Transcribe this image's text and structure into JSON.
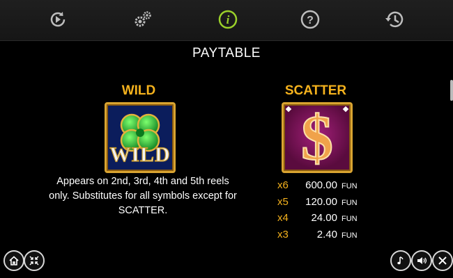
{
  "topbar": {
    "buttons": [
      {
        "name": "autoplay-button",
        "icon": "autoplay-icon"
      },
      {
        "name": "settings-button",
        "icon": "gears-icon"
      },
      {
        "name": "info-button",
        "icon": "info-icon",
        "active": true
      },
      {
        "name": "help-button",
        "icon": "question-icon"
      },
      {
        "name": "history-button",
        "icon": "history-icon"
      }
    ]
  },
  "page": {
    "title": "PAYTABLE"
  },
  "wild": {
    "title": "WILD",
    "symbol_text": "WILD",
    "description": "Appears on 2nd, 3rd, 4th and 5th reels only. Substitutes for all symbols except for SCATTER."
  },
  "scatter": {
    "title": "SCATTER",
    "symbol_glyph": "$",
    "payouts": [
      {
        "multiplier": "x6",
        "value": "600.00",
        "currency": "FUN"
      },
      {
        "multiplier": "x5",
        "value": "120.00",
        "currency": "FUN"
      },
      {
        "multiplier": "x4",
        "value": "24.00",
        "currency": "FUN"
      },
      {
        "multiplier": "x3",
        "value": "2.40",
        "currency": "FUN"
      }
    ]
  },
  "colors": {
    "accent": "#f5b21d",
    "active_icon": "#9bd12a",
    "icon": "#bdbdbd"
  },
  "bottom_controls": {
    "left": [
      "home-icon",
      "minimize-icon"
    ],
    "right": [
      "music-icon",
      "sound-icon",
      "close-icon"
    ]
  }
}
